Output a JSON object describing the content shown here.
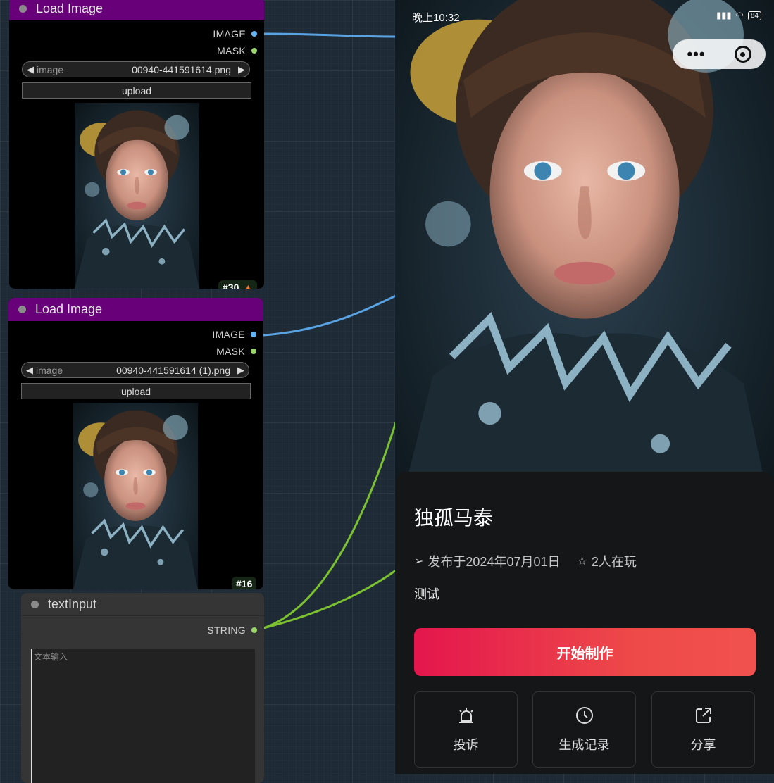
{
  "colors": {
    "node_header": "#670079",
    "port_image": "#64b5f6",
    "port_mask": "#9ad66a",
    "wire_blue": "#5aa3e3",
    "wire_green": "#7cc130",
    "cta_start": "#e4164d",
    "cta_end": "#f0514f"
  },
  "nodes": [
    {
      "title": "Load Image",
      "output_image": "IMAGE",
      "output_mask": "MASK",
      "widget_label": "image",
      "filename": "00940-441591614.png",
      "upload_label": "upload",
      "badge": "#30",
      "badge_icon": "fox-icon"
    },
    {
      "title": "Load Image",
      "output_image": "IMAGE",
      "output_mask": "MASK",
      "widget_label": "image",
      "filename": "00940-441591614 (1).png",
      "upload_label": "upload",
      "badge": "#16"
    }
  ],
  "text_node": {
    "title": "textInput",
    "output": "STRING",
    "placeholder": "文本输入"
  },
  "phone": {
    "status_time": "晚上10:32",
    "battery": "84",
    "title": "独孤马泰",
    "publish": "发布于2024年07月01日",
    "players": "2人在玩",
    "description": "测试",
    "cta": "开始制作",
    "actions": [
      {
        "label": "投诉",
        "icon": "alarm-icon"
      },
      {
        "label": "生成记录",
        "icon": "clock-icon"
      },
      {
        "label": "分享",
        "icon": "share-icon"
      }
    ]
  }
}
